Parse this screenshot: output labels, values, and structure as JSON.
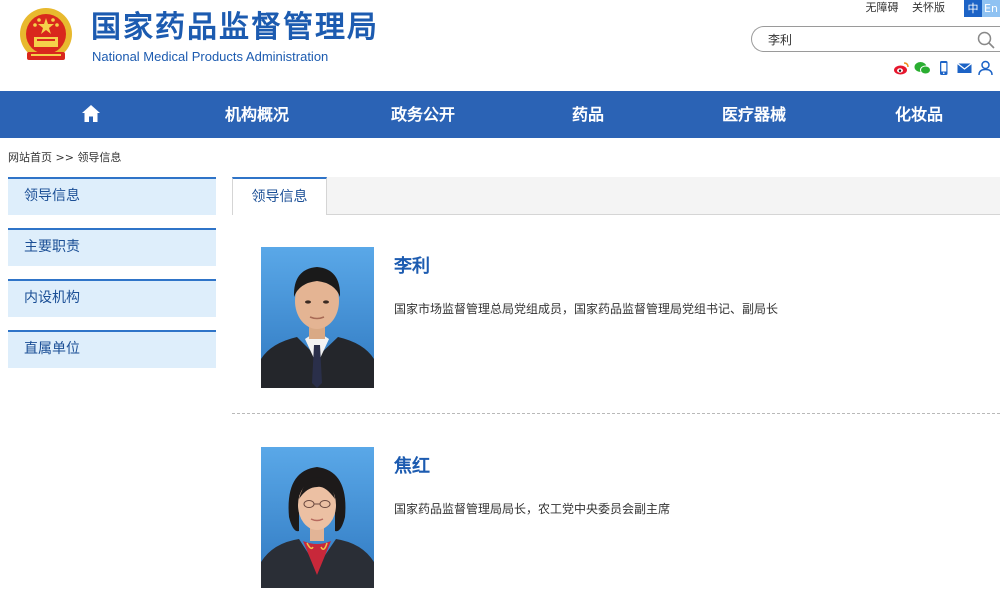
{
  "site": {
    "title_cn": "国家药品监督管理局",
    "title_en": "National Medical Products Administration"
  },
  "top_links": {
    "accessibility": "无障碍",
    "care_version": "关怀版",
    "lang_zh": "中",
    "lang_en": "En"
  },
  "search": {
    "value": "李利"
  },
  "nav": {
    "items": [
      {
        "label": "机构概况"
      },
      {
        "label": "政务公开"
      },
      {
        "label": "药品"
      },
      {
        "label": "医疗器械"
      },
      {
        "label": "化妆品"
      }
    ]
  },
  "breadcrumb": {
    "home": "网站首页",
    "separator": ">>",
    "current": "领导信息"
  },
  "sidebar": {
    "items": [
      {
        "label": "领导信息"
      },
      {
        "label": "主要职责"
      },
      {
        "label": "内设机构"
      },
      {
        "label": "直属单位"
      }
    ]
  },
  "tab": {
    "label": "领导信息"
  },
  "leaders": [
    {
      "name": "李利",
      "description": "国家市场监督管理总局党组成员，国家药品监督管理局党组书记、副局长"
    },
    {
      "name": "焦红",
      "description": "国家药品监督管理局局长，农工党中央委员会副主席"
    }
  ],
  "colors": {
    "brand_blue": "#1c5bb0",
    "nav_blue": "#2b63b5",
    "sidebar_bg": "#deeefb"
  },
  "icons": [
    "national-emblem-icon",
    "search-icon",
    "weibo-icon",
    "wechat-icon",
    "mobile-icon",
    "mail-icon",
    "user-icon",
    "home-icon"
  ]
}
